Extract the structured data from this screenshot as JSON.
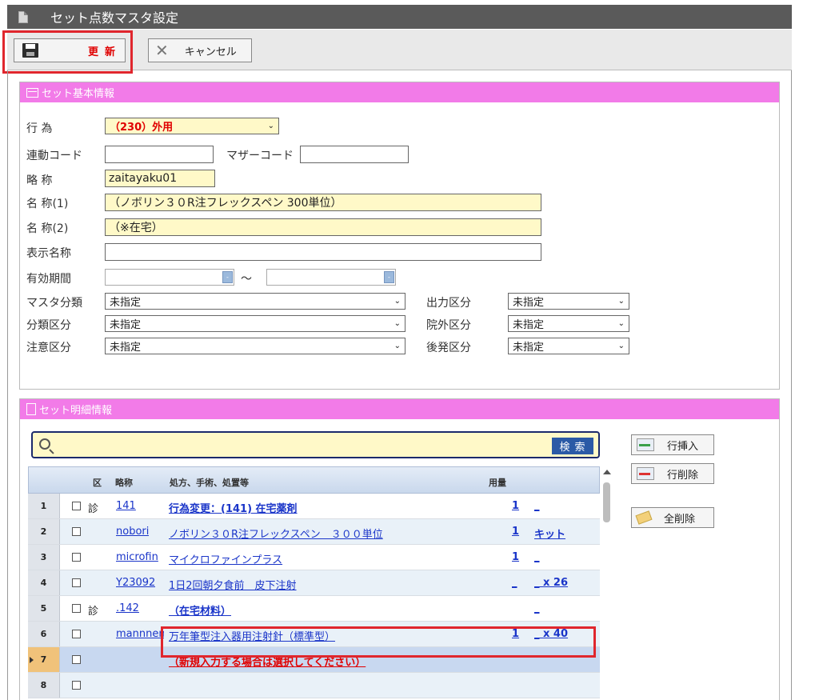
{
  "window": {
    "title": "セット点数マスタ設定"
  },
  "toolbar": {
    "save_label": "更新",
    "cancel_label": "キャンセル"
  },
  "basic": {
    "header": "セット基本情報",
    "act_label": "行 為",
    "act_value": "（230）外用",
    "link_code_label": "連動コード",
    "link_code_value": "",
    "mother_code_label": "マザーコード",
    "mother_code_value": "",
    "abbr_label": "略 称",
    "abbr_value": "zaitayaku01",
    "name1_label": "名 称(1)",
    "name1_value": "（ノボリン３０R注フレックスペン 300単位）",
    "name2_label": "名 称(2)",
    "name2_value": "（※在宅）",
    "display_name_label": "表示名称",
    "display_name_value": "",
    "valid_label": "有効期間",
    "valid_tilde": "～",
    "date_btn_label": "-",
    "master_class_label": "マスタ分類",
    "master_class_value": "未指定",
    "class_div_label": "分類区分",
    "class_div_value": "未指定",
    "caution_label": "注意区分",
    "caution_value": "未指定",
    "output_label": "出力区分",
    "output_value": "未指定",
    "outside_label": "院外区分",
    "outside_value": "未指定",
    "generic_label": "後発区分",
    "generic_value": "未指定"
  },
  "detail": {
    "header": "セット明細情報",
    "search_placeholder": "",
    "search_btn": "検索",
    "insert_btn": "行挿入",
    "delete_btn": "行削除",
    "clear_btn": "全削除",
    "columns": {
      "ku": "区",
      "abbr": "略称",
      "desc": "処方、手術、処置等",
      "qty": "用量"
    },
    "rows": [
      {
        "no": "1",
        "ku": "診",
        "code": "141",
        "desc": "行為変更：(141) 在宅薬剤",
        "qty": "1",
        "unit": "_"
      },
      {
        "no": "2",
        "ku": "",
        "code": "nobori",
        "desc": "ノボリン３０R注フレックスペン　３００単位",
        "qty": "1",
        "unit": "キット"
      },
      {
        "no": "3",
        "ku": "",
        "code": "microfin",
        "desc": "マイクロファインプラス",
        "qty": "1",
        "unit": "_"
      },
      {
        "no": "4",
        "ku": "",
        "code": "Y23092",
        "desc": "1日2回朝夕食前　皮下注射",
        "qty": "_",
        "unit": "_ x 26"
      },
      {
        "no": "5",
        "ku": "診",
        "code": ".142",
        "desc": "（在宅材料）",
        "qty": "",
        "unit": "_"
      },
      {
        "no": "6",
        "ku": "",
        "code": "mannnen",
        "desc": "万年筆型注入器用注射針（標準型）",
        "qty": "1",
        "unit": "_ x 40"
      },
      {
        "no": "7",
        "ku": "",
        "code": "",
        "desc": "（新規入力する場合は選択してください）",
        "qty": "",
        "unit": ""
      },
      {
        "no": "8",
        "ku": "",
        "code": "",
        "desc": "",
        "qty": "",
        "unit": ""
      }
    ]
  }
}
